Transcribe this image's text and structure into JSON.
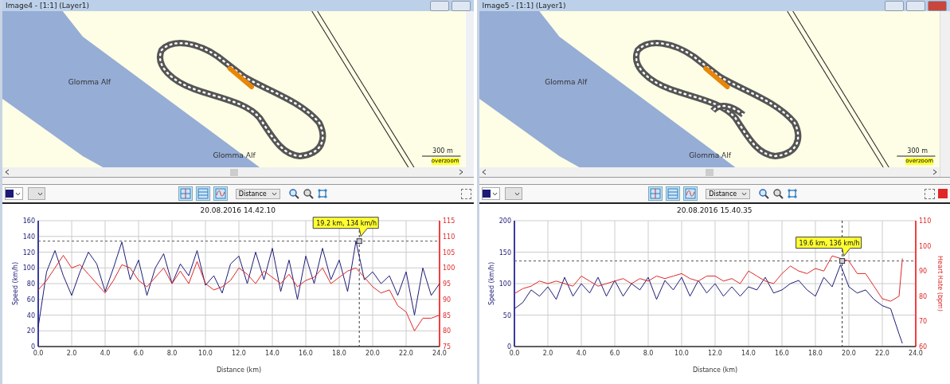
{
  "panels": [
    {
      "title": "Image4 - [1:1] (Layer1)",
      "map": {
        "labels": [
          "Glomma Alf",
          "Glomma Alf"
        ],
        "scale": "300 m",
        "overzoom": "overzoom",
        "vertical_scrollbar": false,
        "track_tail": false
      },
      "toolbar": {
        "view_buttons": [
          {
            "kind": "crosshair",
            "selected": true
          },
          {
            "kind": "bands",
            "selected": true
          },
          {
            "kind": "curve",
            "selected": true
          }
        ],
        "axis_dropdown": "Distance",
        "right_color_swatch": false
      },
      "chart": {
        "title": "20.08.2016 14.42.10",
        "chart_data": {
          "type": "line",
          "xlabel": "Distance (km)",
          "ylabel": "Speed (km/h)",
          "x": [
            0,
            0.5,
            1,
            1.5,
            2,
            2.5,
            3,
            3.5,
            4,
            4.5,
            5,
            5.5,
            6,
            6.5,
            7,
            7.5,
            8,
            8.5,
            9,
            9.5,
            10,
            10.5,
            11,
            11.5,
            12,
            12.5,
            13,
            13.5,
            14,
            14.5,
            15,
            15.5,
            16,
            16.5,
            17,
            17.5,
            18,
            18.5,
            19,
            19.5,
            20,
            20.5,
            21,
            21.5,
            22,
            22.5,
            23,
            23.5,
            24
          ],
          "series": [
            {
              "color": "#1c1c78",
              "values": [
                25,
                95,
                122,
                90,
                65,
                95,
                120,
                105,
                70,
                100,
                133,
                85,
                110,
                65,
                100,
                118,
                80,
                105,
                90,
                122,
                78,
                90,
                68,
                105,
                115,
                80,
                120,
                85,
                125,
                70,
                110,
                60,
                115,
                80,
                125,
                85,
                110,
                70,
                134,
                85,
                95,
                80,
                90,
                65,
                95,
                40,
                100,
                65,
                80
              ]
            },
            {
              "color": "#e02828",
              "axis": "y2",
              "values": [
                93,
                96,
                100,
                104,
                100,
                101,
                98,
                95,
                92,
                96,
                101,
                100,
                96,
                94,
                97,
                100,
                95,
                99,
                95,
                102,
                95,
                93,
                94,
                96,
                100,
                98,
                95,
                99,
                97,
                95,
                98,
                94,
                96,
                97,
                100,
                95,
                97,
                99,
                100,
                97,
                94,
                92,
                93,
                88,
                86,
                80,
                84,
                84,
                85
              ]
            }
          ],
          "xlim": [
            0,
            24
          ],
          "ylim": [
            0,
            160
          ],
          "y2lim": [
            75,
            115
          ],
          "xticks": [
            {
              "value": 0,
              "label": "0.0"
            },
            {
              "value": 2,
              "label": "2.0"
            },
            {
              "value": 4,
              "label": "4.0"
            },
            {
              "value": 6,
              "label": "6.0"
            },
            {
              "value": 8,
              "label": "8.0"
            },
            {
              "value": 10,
              "label": "10.0"
            },
            {
              "value": 12,
              "label": "12.0"
            },
            {
              "value": 14,
              "label": "14.0"
            },
            {
              "value": 16,
              "label": "16.0"
            },
            {
              "value": 18,
              "label": "18.0"
            },
            {
              "value": 20,
              "label": "20.0"
            },
            {
              "value": 22,
              "label": "22.0"
            },
            {
              "value": 24,
              "label": "24.0"
            }
          ],
          "yticks": [
            0,
            20,
            40,
            60,
            80,
            100,
            120,
            140,
            160
          ],
          "y2ticks": [
            75,
            80,
            85,
            90,
            95,
            100,
            105,
            110,
            115
          ],
          "grid": true,
          "ref_lines": [
            {
              "axis": "y",
              "value": 134
            },
            {
              "axis": "x",
              "value": 19.2
            }
          ],
          "annotations": [
            {
              "x": 19.2,
              "y": 134,
              "text": "19.2 km, 134 km/h"
            }
          ]
        }
      }
    },
    {
      "title": "Image5 - [1:1] (Layer1)",
      "map": {
        "labels": [
          "Glomma Alf",
          "Glomma Alf"
        ],
        "scale": "300 m",
        "overzoom": "overzoom",
        "vertical_scrollbar": true,
        "track_tail": true
      },
      "toolbar": {
        "view_buttons": [
          {
            "kind": "crosshair",
            "selected": true
          },
          {
            "kind": "bands",
            "selected": true
          },
          {
            "kind": "curve",
            "selected": true
          }
        ],
        "axis_dropdown": "Distance",
        "right_color_swatch": true
      },
      "chart": {
        "title": "20.08.2016 15.40.35",
        "chart_data": {
          "type": "line",
          "xlabel": "Distance (km)",
          "ylabel": "Speed (km/h)",
          "y2label": "Heart Rate (bpm)",
          "x": [
            0,
            0.5,
            1,
            1.5,
            2,
            2.5,
            3,
            3.5,
            4,
            4.5,
            5,
            5.5,
            6,
            6.5,
            7,
            7.5,
            8,
            8.5,
            9,
            9.5,
            10,
            10.5,
            11,
            11.5,
            12,
            12.5,
            13,
            13.5,
            14,
            14.5,
            15,
            15.5,
            16,
            16.5,
            17,
            17.5,
            18,
            18.5,
            19,
            19.5,
            20,
            20.5,
            21,
            21.5,
            22,
            22.5,
            23,
            23.2
          ],
          "series": [
            {
              "color": "#1c1c78",
              "values": [
                60,
                70,
                90,
                80,
                95,
                75,
                110,
                80,
                100,
                85,
                110,
                80,
                105,
                80,
                100,
                90,
                110,
                75,
                105,
                90,
                110,
                80,
                105,
                85,
                100,
                80,
                95,
                80,
                95,
                90,
                110,
                85,
                90,
                100,
                105,
                90,
                80,
                110,
                95,
                130,
                95,
                85,
                90,
                75,
                65,
                60,
                20,
                5
              ]
            },
            {
              "color": "#e02828",
              "axis": "y2",
              "values": [
                81,
                83,
                84,
                86,
                85,
                86,
                85,
                84,
                88,
                86,
                84,
                85,
                86,
                87,
                85,
                87,
                86,
                88,
                87,
                88,
                89,
                87,
                86,
                88,
                88,
                86,
                87,
                85,
                90,
                88,
                86,
                85,
                89,
                92,
                90,
                89,
                91,
                90,
                96,
                95,
                94,
                89,
                89,
                84,
                79,
                78,
                80,
                95
              ]
            }
          ],
          "xlim": [
            0,
            24
          ],
          "ylim": [
            0,
            200
          ],
          "y2lim": [
            60,
            110
          ],
          "xticks": [
            {
              "value": 0,
              "label": "0.0"
            },
            {
              "value": 2,
              "label": "2.0"
            },
            {
              "value": 4,
              "label": "4.0"
            },
            {
              "value": 6,
              "label": "6.0"
            },
            {
              "value": 8,
              "label": "8.0"
            },
            {
              "value": 10,
              "label": "10.0"
            },
            {
              "value": 12,
              "label": "12.0"
            },
            {
              "value": 14,
              "label": "14.0"
            },
            {
              "value": 16,
              "label": "16.0"
            },
            {
              "value": 18,
              "label": "18.0"
            },
            {
              "value": 20,
              "label": "20.0"
            },
            {
              "value": 22,
              "label": "22.0"
            },
            {
              "value": 24,
              "label": "24.0"
            }
          ],
          "yticks": [
            0,
            50,
            100,
            150,
            200
          ],
          "y2ticks": [
            60,
            70,
            80,
            90,
            100,
            110
          ],
          "grid": true,
          "ref_lines": [
            {
              "axis": "y",
              "value": 136
            },
            {
              "axis": "x",
              "value": 19.6
            }
          ],
          "annotations": [
            {
              "x": 19.6,
              "y": 136,
              "text": "19.6 km, 136 km/h"
            }
          ]
        }
      }
    }
  ]
}
